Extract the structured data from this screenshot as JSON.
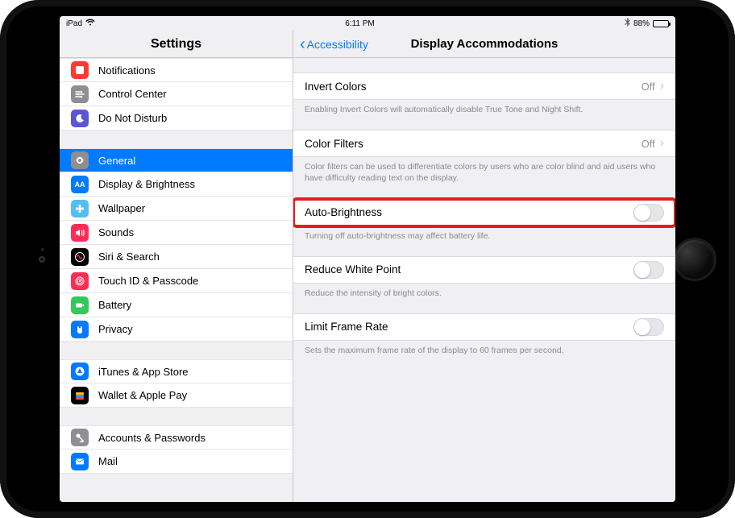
{
  "statusbar": {
    "device": "iPad",
    "time": "6:11 PM",
    "battery": "88%"
  },
  "sidebar": {
    "title": "Settings",
    "section1": [
      {
        "label": "Notifications",
        "icon": "square-red",
        "color": "bg-red"
      },
      {
        "label": "Control Center",
        "icon": "switches",
        "color": "bg-gray"
      },
      {
        "label": "Do Not Disturb",
        "icon": "moon",
        "color": "bg-purple"
      }
    ],
    "section2": [
      {
        "label": "General",
        "icon": "gear",
        "color": "bg-gray",
        "selected": true
      },
      {
        "label": "Display & Brightness",
        "icon": "AA",
        "color": "bg-blue"
      },
      {
        "label": "Wallpaper",
        "icon": "flower",
        "color": "bg-cyan"
      },
      {
        "label": "Sounds",
        "icon": "speaker",
        "color": "bg-pink"
      },
      {
        "label": "Siri & Search",
        "icon": "siri",
        "color": "bg-black"
      },
      {
        "label": "Touch ID & Passcode",
        "icon": "touchid",
        "color": "bg-pink"
      },
      {
        "label": "Battery",
        "icon": "battery",
        "color": "bg-green"
      },
      {
        "label": "Privacy",
        "icon": "hand",
        "color": "bg-hand"
      }
    ],
    "section3": [
      {
        "label": "iTunes & App Store",
        "icon": "appstore",
        "color": "bg-blue"
      },
      {
        "label": "Wallet & Apple Pay",
        "icon": "wallet",
        "color": "bg-black"
      }
    ],
    "section4": [
      {
        "label": "Accounts & Passwords",
        "icon": "key",
        "color": "bg-gray"
      },
      {
        "label": "Mail",
        "icon": "mail",
        "color": "bg-blue"
      }
    ]
  },
  "detail": {
    "back": "Accessibility",
    "title": "Display Accommodations",
    "groups": [
      {
        "type": "disclosure",
        "label": "Invert Colors",
        "value": "Off",
        "note": "Enabling Invert Colors will automatically disable True Tone and Night Shift."
      },
      {
        "type": "disclosure",
        "label": "Color Filters",
        "value": "Off",
        "note": "Color filters can be used to differentiate colors by users who are color blind and aid users who have difficulty reading text on the display."
      },
      {
        "type": "toggle",
        "label": "Auto-Brightness",
        "on": false,
        "highlight": true,
        "note": "Turning off auto-brightness may affect battery life."
      },
      {
        "type": "toggle",
        "label": "Reduce White Point",
        "on": false,
        "note": "Reduce the intensity of bright colors."
      },
      {
        "type": "toggle",
        "label": "Limit Frame Rate",
        "on": false,
        "note": "Sets the maximum frame rate of the display to 60 frames per second."
      }
    ]
  }
}
